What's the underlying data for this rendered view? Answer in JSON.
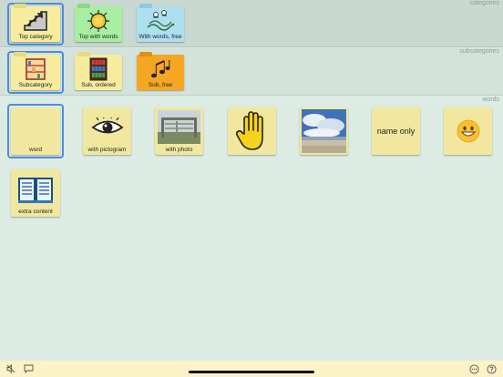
{
  "sections": {
    "categories": "categories",
    "subcategories": "subcategories",
    "words": "words"
  },
  "categories": [
    {
      "label": "Top category",
      "icon": "stairs-icon",
      "color": "#f7eb9e",
      "selected": true
    },
    {
      "label": "Top with words",
      "icon": "sun-icon",
      "color": "#a8eea0"
    },
    {
      "label": "With words, free",
      "icon": "ducks-icon",
      "color": "#acdff0"
    }
  ],
  "subcategories": [
    {
      "label": "Subcategory",
      "icon": "shelf-icon",
      "color": "#f7eb9e",
      "selected": true
    },
    {
      "label": "Sub, ordered",
      "icon": "bookcase-icon",
      "color": "#f7eb9e"
    },
    {
      "label": "Sub, free",
      "icon": "music-notes-icon",
      "color": "#f5a623"
    }
  ],
  "words": [
    {
      "label": "word",
      "icon": "",
      "selected": true
    },
    {
      "label": "with pictogram",
      "icon": "eye-icon"
    },
    {
      "label": "with photo",
      "icon": "gate-photo"
    },
    {
      "label": "",
      "icon": "hand-icon"
    },
    {
      "label": "",
      "icon": "beach-photo"
    },
    {
      "text": "name only"
    },
    {
      "label": "",
      "icon": "smiley-icon"
    },
    {
      "label": "extra content",
      "icon": "book-icon"
    }
  ],
  "colors": {
    "accent": "#4a8ee0",
    "word_card": "#f1e79f",
    "bottom_bar": "#fbf2c6"
  },
  "bottom_bar": {
    "left_icons": [
      "speaker-mute-icon",
      "speech-bubble-icon"
    ],
    "right_icons": [
      "more-icon",
      "help-icon"
    ]
  }
}
